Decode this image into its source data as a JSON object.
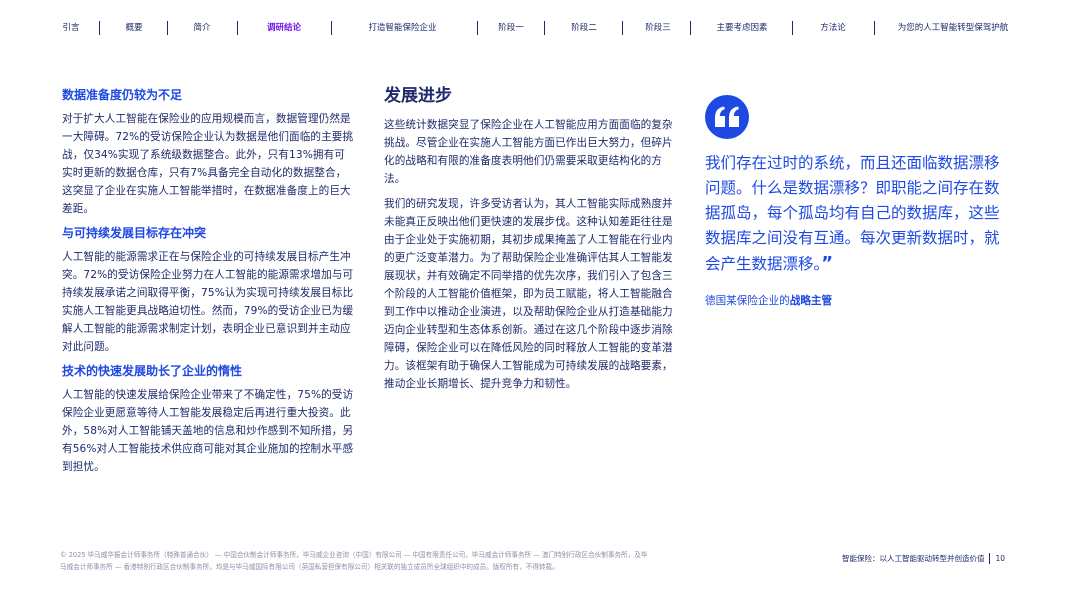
{
  "nav": {
    "items": [
      {
        "label": "引言"
      },
      {
        "label": "概要"
      },
      {
        "label": "简介"
      },
      {
        "label": "调研结论"
      },
      {
        "label": "打造智能保险企业"
      },
      {
        "label": "阶段一"
      },
      {
        "label": "阶段二"
      },
      {
        "label": "阶段三"
      },
      {
        "label": "主要考虑因素"
      },
      {
        "label": "方法论"
      },
      {
        "label": "为您的人工智能转型保驾护航"
      }
    ],
    "active_index": 3
  },
  "left": {
    "sections": [
      {
        "heading": "数据准备度仍较为不足",
        "body": "对于扩大人工智能在保险业的应用规模而言，数据管理仍然是一大障碍。72%的受访保险企业认为数据是他们面临的主要挑战，仅34%实现了系统级数据整合。此外，只有13%拥有可实时更新的数据仓库，只有7%具备完全自动化的数据整合，这突显了企业在实施人工智能举措时，在数据准备度上的巨大差距。"
      },
      {
        "heading": "与可持续发展目标存在冲突",
        "body": "人工智能的能源需求正在与保险企业的可持续发展目标产生冲突。72%的受访保险企业努力在人工智能的能源需求增加与可持续发展承诺之间取得平衡，75%认为实现可持续发展目标比实施人工智能更具战略迫切性。然而，79%的受访企业已为缓解人工智能的能源需求制定计划，表明企业已意识到并主动应对此问题。"
      },
      {
        "heading": "技术的快速发展助长了企业的惰性",
        "body": "人工智能的快速发展给保险企业带来了不确定性，75%的受访保险企业更愿意等待人工智能发展稳定后再进行重大投资。此外，58%对人工智能铺天盖地的信息和炒作感到不知所措，另有56%对人工智能技术供应商可能对其企业施加的控制水平感到担忧。"
      }
    ]
  },
  "middle": {
    "heading": "发展进步",
    "paragraphs": [
      "这些统计数据突显了保险企业在人工智能应用方面面临的复杂挑战。尽管企业在实施人工智能方面已作出巨大努力，但碎片化的战略和有限的准备度表明他们仍需要采取更结构化的方法。",
      "我们的研究发现，许多受访者认为，其人工智能实际成熟度并未能真正反映出他们更快速的发展步伐。这种认知差距往往是由于企业处于实施初期，其初步成果掩盖了人工智能在行业内的更广泛变革潜力。为了帮助保险企业准确评估其人工智能发展现状，并有效确定不同举措的优先次序，我们引入了包含三个阶段的人工智能价值框架，即为员工赋能，将人工智能融合到工作中以推动企业演进，以及帮助保险企业从打造基础能力迈向企业转型和生态体系创新。通过在这几个阶段中逐步消除障碍，保险企业可以在降低风险的同时释放人工智能的变革潜力。该框架有助于确保人工智能成为可持续发展的战略要素，推动企业长期增长、提升竞争力和韧性。"
    ]
  },
  "quote": {
    "icon": "quote-open-icon",
    "text": "我们存在过时的系统，而且还面临数据漂移问题。什么是数据漂移？即职能之间存在数据孤岛，每个孤岛均有自己的数据库，这些数据库之间没有互通。每次更新数据时，就会产生数据漂移。",
    "close_mark": "”",
    "attribution_prefix": "德国某保险企业的",
    "attribution_role": "战略主管"
  },
  "footer": {
    "legal": "© 2025 毕马威华振会计师事务所（特殊普通合伙） — 中国合伙制会计师事务所，毕马威企业咨询（中国）有限公司 — 中国有限责任公司，毕马威会计师事务所 — 澳门特别行政区合伙制事务所，及毕马威会计师事务所 — 香港特别行政区合伙制事务所，均是与毕马威国际有限公司（英国私营担保有限公司）相关联的独立成员所全球组织中的成员。版权所有，不得转载。",
    "doc_title": "智能保险：以人工智能驱动转型并创造价值",
    "page_number": "10"
  },
  "colors": {
    "accent_blue": "#1e49e2",
    "navy": "#1e2a6b",
    "active_purple": "#7213ea"
  }
}
